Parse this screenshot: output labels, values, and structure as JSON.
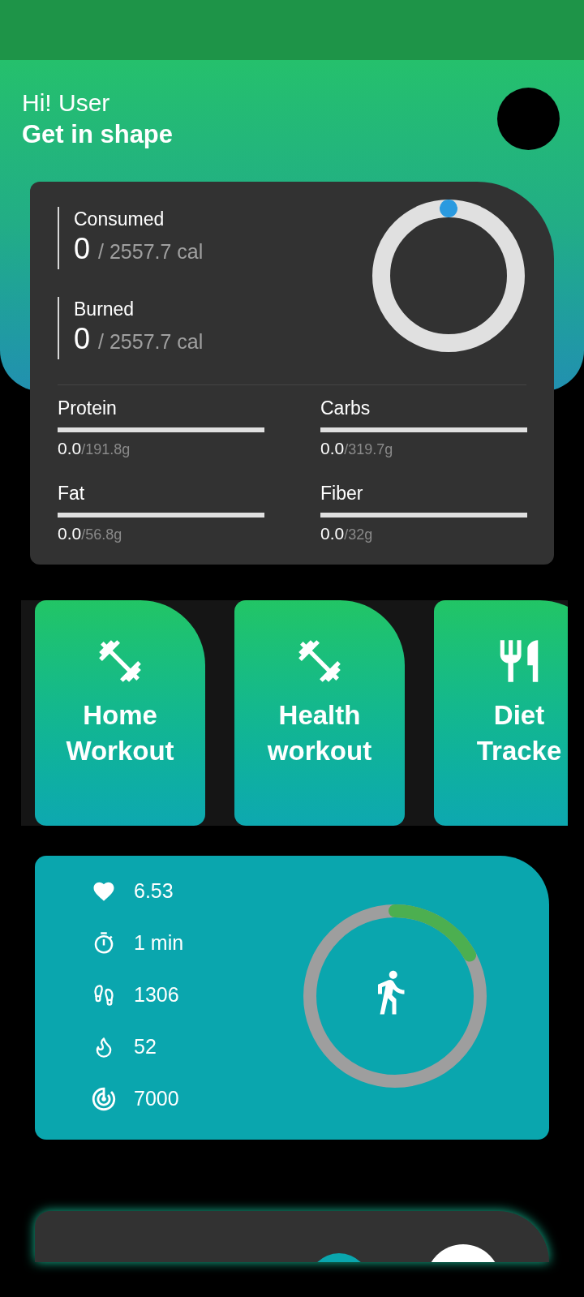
{
  "greeting": "Hi! User",
  "subtitle": "Get in shape",
  "calories": {
    "entries": [
      {
        "label": "Consumed",
        "value": "0",
        "target": "/ 2557.7 cal"
      },
      {
        "label": "Burned",
        "value": "0",
        "target": "/ 2557.7 cal"
      }
    ]
  },
  "macros": [
    {
      "label": "Protein",
      "value": "0.0",
      "target": "/191.8g",
      "level": 0
    },
    {
      "label": "Carbs",
      "value": "0.0",
      "target": "/319.7g",
      "level": 0
    },
    {
      "label": "Fat",
      "value": "0.0",
      "target": "/56.8g",
      "level": 0
    },
    {
      "label": "Fiber",
      "value": "0.0",
      "target": "/32g",
      "level": 0
    }
  ],
  "shortcuts": [
    {
      "kind": "dumbbell",
      "lines": [
        "Home",
        "Workout"
      ]
    },
    {
      "kind": "dumbbell",
      "lines": [
        "Health",
        "workout"
      ]
    },
    {
      "kind": "food",
      "lines": [
        "Diet",
        "Tracke"
      ]
    }
  ],
  "activity": {
    "level": 0.17,
    "stats": [
      {
        "kind": "heart",
        "value": "6.53"
      },
      {
        "kind": "timer",
        "value": "1 min"
      },
      {
        "kind": "steps",
        "value": "1306"
      },
      {
        "kind": "flame",
        "value": "52"
      },
      {
        "kind": "target",
        "value": "7000"
      }
    ]
  }
}
